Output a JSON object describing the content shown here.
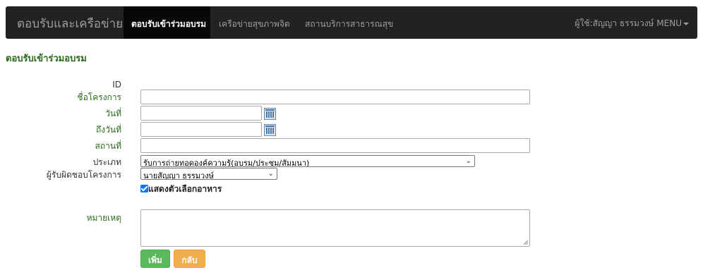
{
  "navbar": {
    "brand": "ตอบรับและเครือข่าย",
    "links": [
      {
        "label": "ตอบรับเข้าร่วมอบรม",
        "active": true
      },
      {
        "label": "เครือข่ายสุขภาพจิต",
        "active": false
      },
      {
        "label": "สถานบริการสาธารณสุข",
        "active": false
      }
    ],
    "user": "ผู้ใช้:สัญญา ธรรมวงษ์",
    "menu": "MENU"
  },
  "page": {
    "title": "ตอบรับเข้าร่วมอบรม"
  },
  "form": {
    "id_label": "ID",
    "project_label": "ชื่อโครงการ",
    "project_value": "",
    "date_label": "วันที่",
    "date_value": "",
    "to_date_label": "ถึงวันที่",
    "to_date_value": "",
    "place_label": "สถานที่",
    "place_value": "",
    "type_label": "ประเภท",
    "type_value": "รับการถ่ายทอดองค์ความรู้(อบรม/ประชุม/สัมมนา)",
    "owner_label": "ผู้รับผิดชอบโครงการ",
    "owner_value": "นายสัญญา ธรรมวงษ์",
    "food_checkbox_label": "แสดงตัวเลือกอาหาร",
    "food_checked": true,
    "remark_label": "หมายเหตุ",
    "remark_value": "",
    "add_button": "เพิ่ม",
    "back_button": "กลับ"
  },
  "colors": {
    "navbar_bg": "#222222",
    "label_green": "#2a6a1a",
    "btn_success": "#5cb85c",
    "btn_warning": "#f0ad4e"
  }
}
